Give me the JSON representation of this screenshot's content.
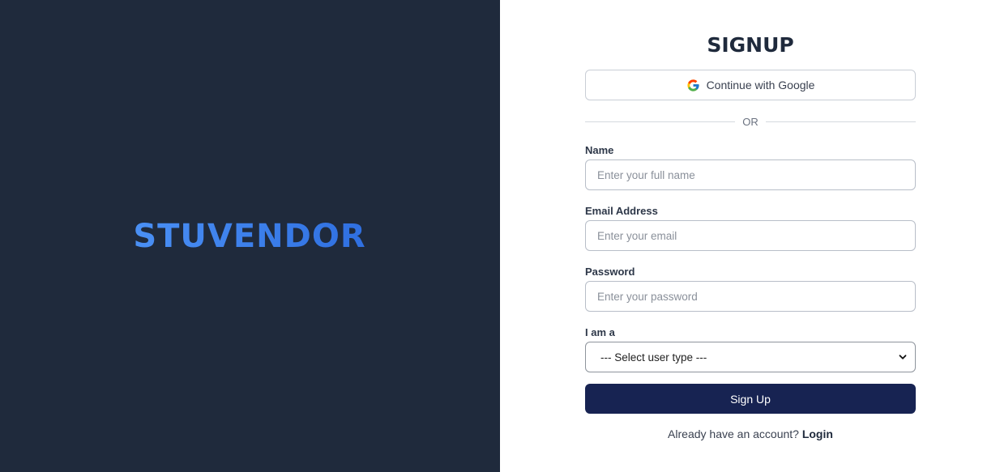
{
  "brand": {
    "name": "STUVENDOR",
    "gradient_start": "#4a90f5",
    "gradient_end": "#2f6fe0"
  },
  "colors": {
    "left_panel_bg": "#1f2a3c",
    "primary_button": "#172352"
  },
  "form": {
    "title": "SIGNUP",
    "google_button_label": "Continue with Google",
    "google_icon": "google-g-icon",
    "divider_text": "OR",
    "fields": {
      "name": {
        "label": "Name",
        "placeholder": "Enter your full name",
        "value": ""
      },
      "email": {
        "label": "Email Address",
        "placeholder": "Enter your email",
        "value": ""
      },
      "password": {
        "label": "Password",
        "placeholder": "Enter your password",
        "value": ""
      },
      "user_type": {
        "label": "I am a",
        "selected": "--- Select user type ---"
      }
    },
    "submit_label": "Sign Up",
    "footer_text": "Already have an account?",
    "login_link_label": "Login"
  }
}
